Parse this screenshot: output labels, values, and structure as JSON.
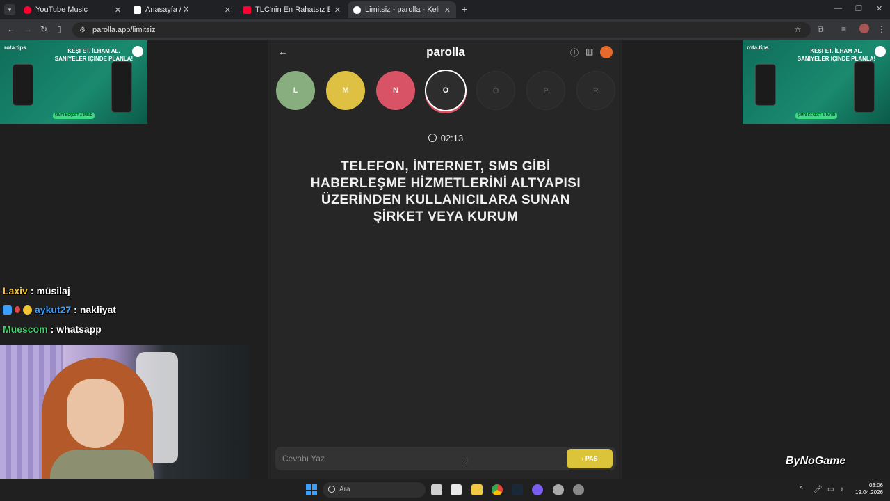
{
  "browser": {
    "tabs": [
      {
        "label": "YouTube Music",
        "favicon_color": "#ff0033"
      },
      {
        "label": "Anasayfa / X",
        "favicon_color": "#ffffff"
      },
      {
        "label": "TLC'nin En Rahatsız Edici Progr...",
        "favicon_color": "#ff0033"
      },
      {
        "label": "Limitsiz - parolla - Kelime oyunu",
        "favicon_color": "#ffffff"
      }
    ],
    "url": "parolla.app/limitsiz"
  },
  "ads": {
    "brand": "rota.tips",
    "headline_1": "KEŞFET. İLHAM AL.",
    "headline_2": "SANİYELER İÇİNDE PLANLA!",
    "cta": "ŞİMDİ KEŞFET & İNDİR"
  },
  "chat": [
    {
      "user": "Laxiv",
      "message": "müsilaj",
      "user_color": "#f4c430"
    },
    {
      "user": "aykut27",
      "message": "nakliyat",
      "user_color": "#3aa0ff"
    },
    {
      "user": "Muescom",
      "message": "whatsapp",
      "user_color": "#3dd36a"
    }
  ],
  "app": {
    "title": "parolla",
    "letters": [
      "L",
      "M",
      "N",
      "O",
      "Ö",
      "P",
      "R"
    ],
    "letter_states": [
      "correct",
      "skipped",
      "wrong",
      "current",
      "pending",
      "pending",
      "pending"
    ],
    "timer": "02:13",
    "question": "TELEFON, İNTERNET, SMS GİBİ HABERLEŞME HİZMETLERİNİ ALTYAPISI ÜZERİNDEN KULLANICILARA SUNAN ŞİRKET VEYA KURUM",
    "answer_placeholder": "Cevabı Yaz",
    "pass_label": "PAS"
  },
  "overlay": {
    "sponsor": "ByNoGame"
  },
  "taskbar": {
    "search_label": "Ara",
    "time": "03:06",
    "date": "19.04.2026"
  },
  "colors": {
    "correct": "#88ae7f",
    "skipped": "#dec042",
    "wrong": "#d95367",
    "pass_button": "#dcc43a"
  }
}
